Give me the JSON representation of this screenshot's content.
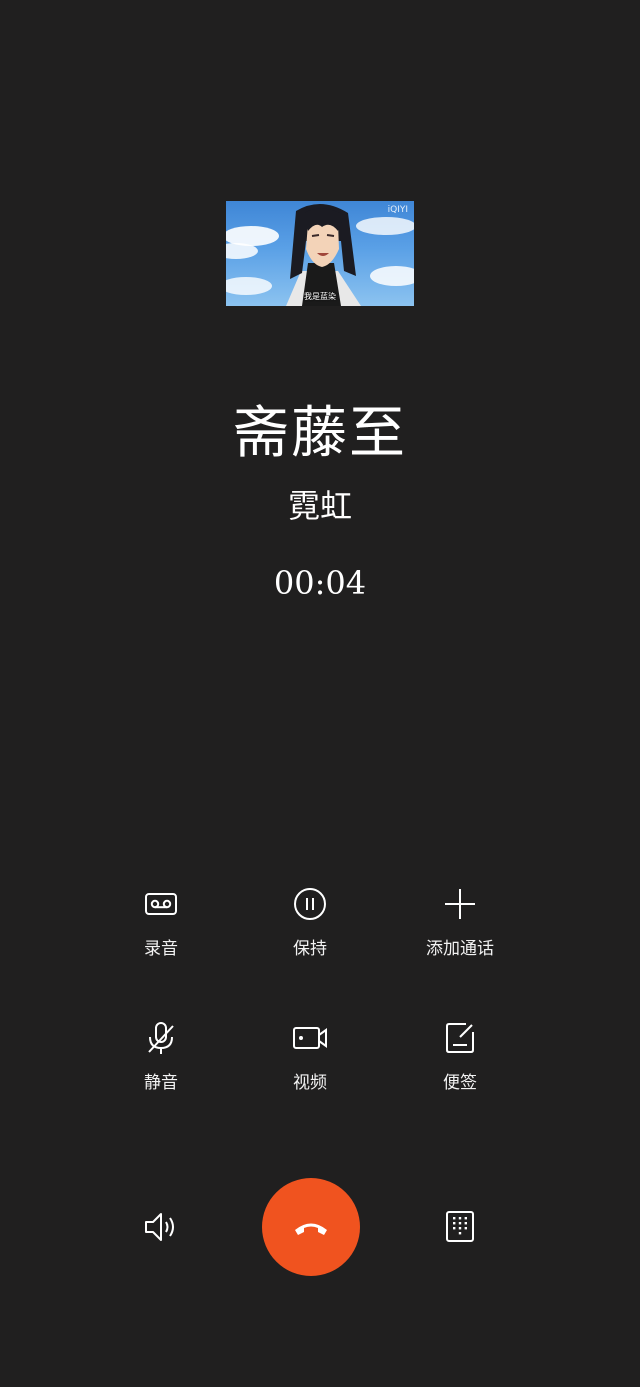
{
  "caller": {
    "name": "斋藤至",
    "location": "霓虹",
    "avatar_caption": "我是蓝染",
    "avatar_logo": "iQIYI"
  },
  "call": {
    "timer": "00:04"
  },
  "actions": [
    {
      "id": "record",
      "label": "录音",
      "icon": "record-tape-icon"
    },
    {
      "id": "hold",
      "label": "保持",
      "icon": "pause-circle-icon"
    },
    {
      "id": "add_call",
      "label": "添加通话",
      "icon": "plus-icon"
    },
    {
      "id": "mute",
      "label": "静音",
      "icon": "mic-off-icon"
    },
    {
      "id": "video",
      "label": "视频",
      "icon": "video-camera-icon"
    },
    {
      "id": "notes",
      "label": "便签",
      "icon": "note-edit-icon"
    }
  ],
  "bottom_bar": {
    "speaker_icon": "speaker-icon",
    "end_call_icon": "hang-up-icon",
    "end_call_color": "#f0531f",
    "keypad_icon": "dialpad-icon"
  }
}
